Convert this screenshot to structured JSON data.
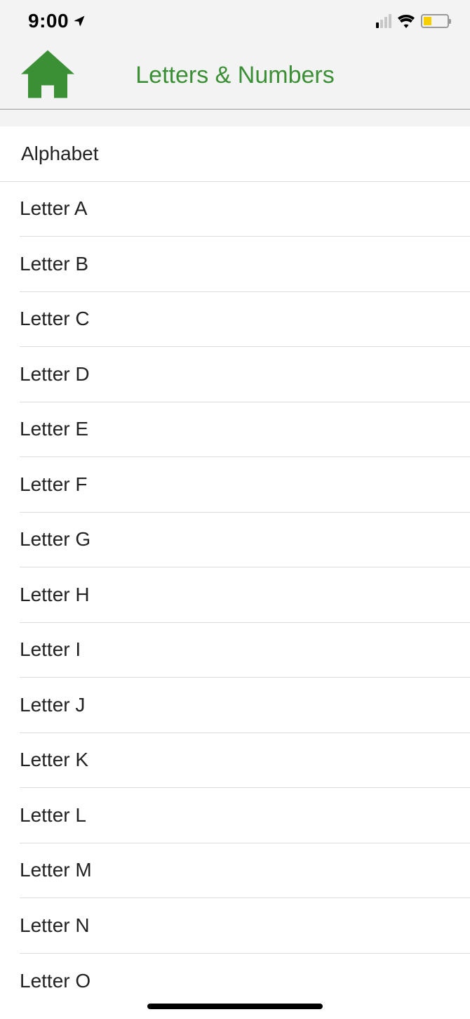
{
  "status": {
    "time": "9:00"
  },
  "nav": {
    "title": "Letters & Numbers"
  },
  "list": {
    "items": [
      {
        "label": "Alphabet"
      },
      {
        "label": "Letter A"
      },
      {
        "label": "Letter B"
      },
      {
        "label": "Letter C"
      },
      {
        "label": "Letter D"
      },
      {
        "label": "Letter E"
      },
      {
        "label": "Letter F"
      },
      {
        "label": "Letter G"
      },
      {
        "label": "Letter H"
      },
      {
        "label": "Letter I"
      },
      {
        "label": "Letter J"
      },
      {
        "label": "Letter K"
      },
      {
        "label": "Letter L"
      },
      {
        "label": "Letter M"
      },
      {
        "label": "Letter N"
      },
      {
        "label": "Letter O"
      }
    ]
  }
}
